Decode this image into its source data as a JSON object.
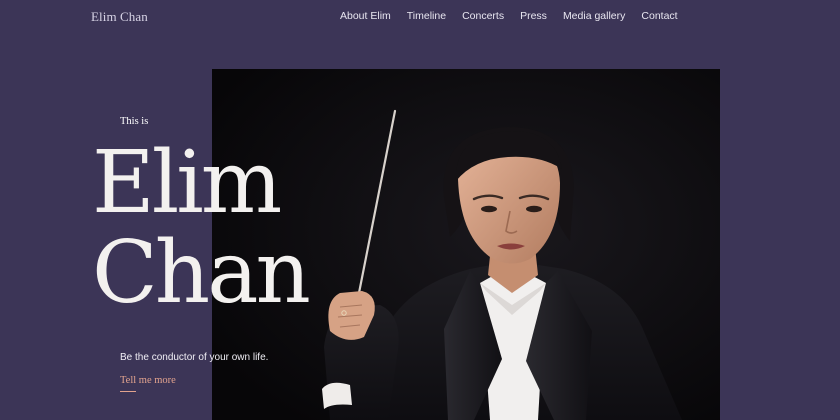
{
  "header": {
    "logo": "Elim Chan",
    "nav": [
      {
        "label": "About Elim"
      },
      {
        "label": "Timeline"
      },
      {
        "label": "Concerts"
      },
      {
        "label": "Press"
      },
      {
        "label": "Media gallery"
      },
      {
        "label": "Contact"
      }
    ]
  },
  "hero": {
    "eyebrow": "This is",
    "title_line1": "Elim",
    "title_line2": "Chan",
    "tagline": "Be the conductor of your own life.",
    "cta_label": "Tell me more",
    "photo_subject": "conductor-portrait"
  },
  "colors": {
    "background": "#3c3557",
    "photo_background": "#0c0b0e",
    "accent": "#e2a38e",
    "text": "#ffffff"
  }
}
